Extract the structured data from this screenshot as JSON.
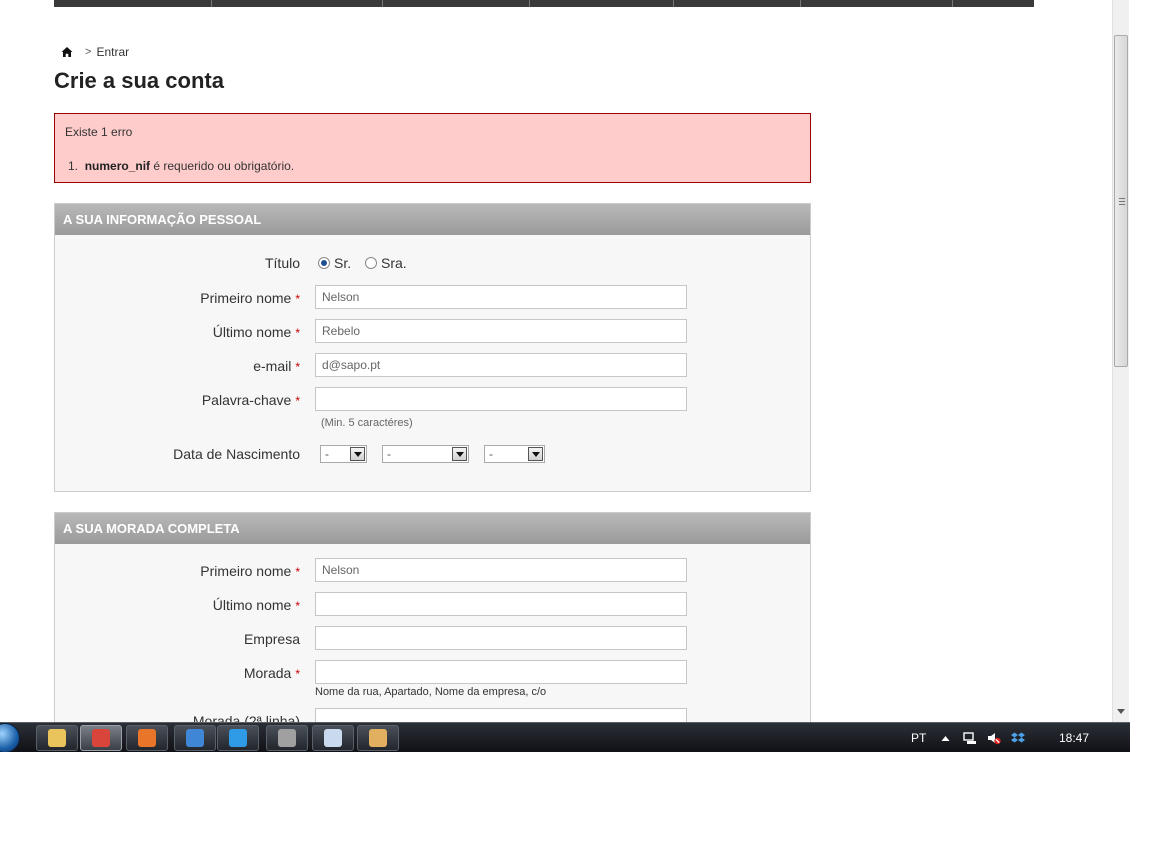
{
  "breadcrumb": {
    "home_icon": "home-icon",
    "separator": ">",
    "current": "Entrar"
  },
  "page_title": "Crie a sua conta",
  "errors": {
    "heading": "Existe 1 erro",
    "items": [
      {
        "number": "1.",
        "field": "numero_nif",
        "message": " é requerido ou obrigatório."
      }
    ]
  },
  "personal": {
    "header": "A SUA INFORMAÇÃO PESSOAL",
    "title_label": "Título",
    "title_options": [
      {
        "label": "Sr.",
        "selected": true
      },
      {
        "label": "Sra.",
        "selected": false
      }
    ],
    "first_name_label": "Primeiro nome",
    "first_name_value": "Nelson",
    "last_name_label": "Último nome",
    "last_name_value": "Rebelo",
    "email_label": "e-mail",
    "email_value": "d@sapo.pt",
    "password_label": "Palavra-chave",
    "password_value": "",
    "password_hint": "(Min. 5 caractéres)",
    "birth_label": "Data de Nascimento",
    "birth_day": "-",
    "birth_month": "-",
    "birth_year": "-"
  },
  "address": {
    "header": "A SUA MORADA COMPLETA",
    "first_name_label": "Primeiro nome",
    "first_name_value": "Nelson",
    "last_name_label": "Último nome",
    "last_name_value": "",
    "company_label": "Empresa",
    "company_value": "",
    "address_label": "Morada",
    "address_value": "",
    "address_hint": "Nome da rua, Apartado, Nome da empresa, c/o",
    "address2_label": "Morada (2ª linha)"
  },
  "required_mark": "*",
  "taskbar": {
    "apps": [
      {
        "name": "explorer-icon",
        "color": "#e8c45a"
      },
      {
        "name": "chrome-icon",
        "color": "#d9453b"
      },
      {
        "name": "firefox-icon",
        "color": "#e8752a"
      },
      {
        "name": "mail-icon",
        "color": "#3f86d6"
      },
      {
        "name": "ie-icon",
        "color": "#2f9be6"
      },
      {
        "name": "search-tool-icon",
        "color": "#a0a0a0"
      },
      {
        "name": "notepad-icon",
        "color": "#c9d9ee"
      },
      {
        "name": "paint-icon",
        "color": "#e0b060"
      }
    ],
    "language": "PT",
    "clock": "18:47"
  }
}
